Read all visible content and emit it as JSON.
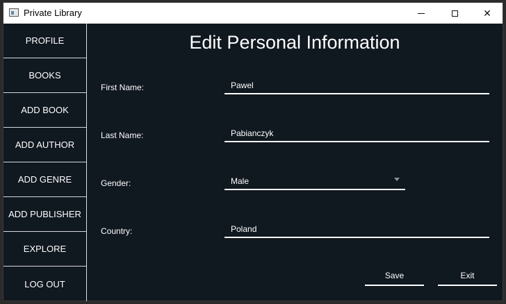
{
  "window": {
    "title": "Private Library"
  },
  "titlebar": {
    "minimize": "",
    "maximize": "",
    "close": "✕"
  },
  "sidebar": {
    "items": [
      {
        "label": "PROFILE"
      },
      {
        "label": "BOOKS"
      },
      {
        "label": "ADD BOOK"
      },
      {
        "label": "ADD AUTHOR"
      },
      {
        "label": "ADD GENRE"
      },
      {
        "label": "ADD PUBLISHER"
      },
      {
        "label": "EXPLORE"
      },
      {
        "label": "LOG OUT"
      }
    ]
  },
  "form": {
    "title": "Edit Personal Information",
    "first_name": {
      "label": "First Name:",
      "value": "Pawel"
    },
    "last_name": {
      "label": "Last Name:",
      "value": "Pabianczyk"
    },
    "gender": {
      "label": "Gender:",
      "value": "Male"
    },
    "country": {
      "label": "Country:",
      "value": "Poland"
    },
    "save_label": "Save",
    "exit_label": "Exit"
  },
  "colors": {
    "background": "#101820",
    "text": "#ffffff",
    "titlebar": "#ffffff"
  }
}
